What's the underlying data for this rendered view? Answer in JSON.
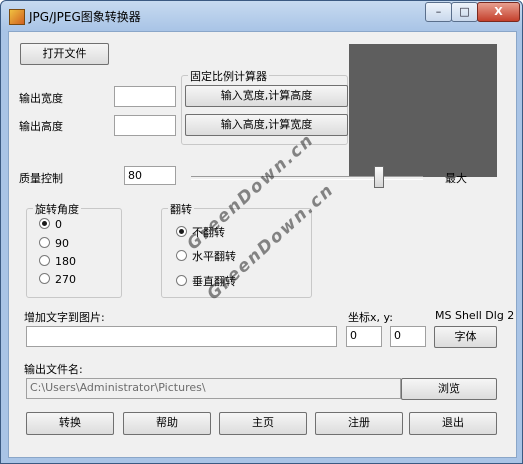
{
  "window": {
    "title": "JPG/JPEG图象转换器",
    "controls": {
      "minimize": "–",
      "maximize": "□",
      "close": "X"
    }
  },
  "file": {
    "open_button": "打开文件"
  },
  "size": {
    "width_label": "输出宽度",
    "height_label": "输出高度",
    "width_value": "",
    "height_value": ""
  },
  "ratio": {
    "group_title": "固定比例计算器",
    "calc_height_button": "输入宽度,计算高度",
    "calc_width_button": "输入高度,计算宽度"
  },
  "quality": {
    "label": "质量控制",
    "value": "80",
    "max_label": "最大",
    "slider_level": 0.8
  },
  "rotation": {
    "group_title": "旋转角度",
    "options": [
      "0",
      "90",
      "180",
      "270"
    ],
    "selected": "0"
  },
  "flip": {
    "group_title": "翻转",
    "options": [
      "不翻转",
      "水平翻转",
      "垂直翻转"
    ],
    "selected": "不翻转"
  },
  "text_overlay": {
    "label": "增加文字到图片:",
    "value": "",
    "coord_label": "坐标x, y:",
    "x": "0",
    "y": "0",
    "font_name": "MS Shell Dlg 2",
    "font_button": "字体"
  },
  "output": {
    "label": "输出文件名:",
    "path": "C:\\Users\\Administrator\\Pictures\\",
    "browse_button": "浏览"
  },
  "actions": {
    "convert": "转换",
    "help": "帮助",
    "home": "主页",
    "register": "注册",
    "exit": "退出"
  },
  "watermark": "GreenDown.cn"
}
